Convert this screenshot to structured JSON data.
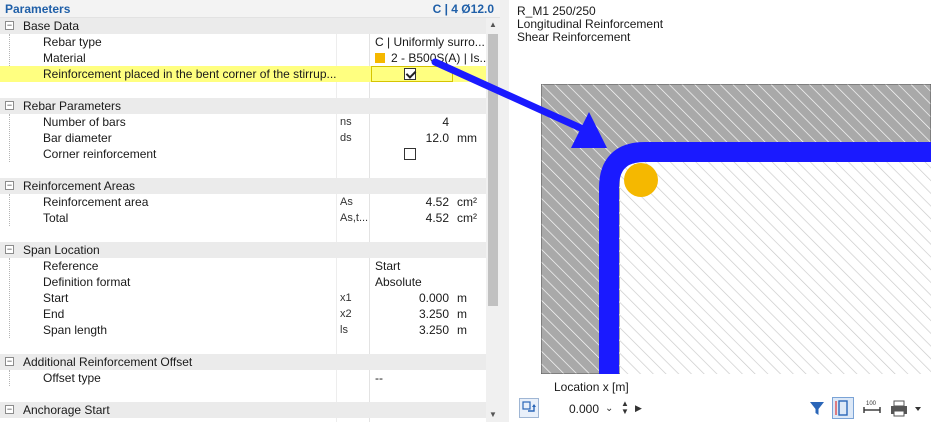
{
  "panel": {
    "title": "Parameters",
    "summary": "C | 4 Ø12.0"
  },
  "sections": {
    "base_data": {
      "label": "Base Data",
      "rebar_type_label": "Rebar type",
      "rebar_type_value": "C | Uniformly surro...",
      "material_label": "Material",
      "material_value": "2 - B500S(A) | Is...",
      "material_color": "#f5b800",
      "bent_corner_label": "Reinforcement placed in the bent corner of the stirrup...",
      "bent_corner_checked": true
    },
    "rebar_parameters": {
      "label": "Rebar Parameters",
      "num_bars_label": "Number of bars",
      "num_bars_symbol": "ns",
      "num_bars_value": "4",
      "bar_diameter_label": "Bar diameter",
      "bar_diameter_symbol": "ds",
      "bar_diameter_value": "12.0",
      "bar_diameter_unit": "mm",
      "corner_label": "Corner reinforcement",
      "corner_checked": false
    },
    "reinforcement_areas": {
      "label": "Reinforcement Areas",
      "area_label": "Reinforcement area",
      "area_symbol": "As",
      "area_value": "4.52",
      "area_unit": "cm²",
      "total_label": "Total",
      "total_symbol": "As,t...",
      "total_value": "4.52",
      "total_unit": "cm²"
    },
    "span_location": {
      "label": "Span Location",
      "reference_label": "Reference",
      "reference_value": "Start",
      "definition_label": "Definition format",
      "definition_value": "Absolute",
      "start_label": "Start",
      "start_symbol": "x1",
      "start_value": "0.000",
      "start_unit": "m",
      "end_label": "End",
      "end_symbol": "x2",
      "end_value": "3.250",
      "end_unit": "m",
      "span_label": "Span length",
      "span_symbol": "ls",
      "span_value": "3.250",
      "span_unit": "m"
    },
    "additional_offset": {
      "label": "Additional Reinforcement Offset",
      "offset_type_label": "Offset type",
      "offset_type_value": "--"
    },
    "anchorage_start": {
      "label": "Anchorage Start"
    }
  },
  "preview": {
    "section_name": "R_M1 250/250",
    "line2": "Longitudinal Reinforcement",
    "line3": "Shear Reinforcement",
    "location_label": "Location x [m]",
    "location_value": "0.000",
    "stirrup_color": "#1a1aff",
    "bar_color": "#f5b800",
    "arrow_color": "#1a1aff"
  },
  "icons": [
    "expand-collapse-icon",
    "checkbox-icon",
    "scroll-up-icon",
    "scroll-down-icon",
    "sync-view-icon",
    "filter-icon",
    "dimension-icon",
    "scale-icon",
    "print-icon",
    "dropdown-arrow-icon"
  ]
}
